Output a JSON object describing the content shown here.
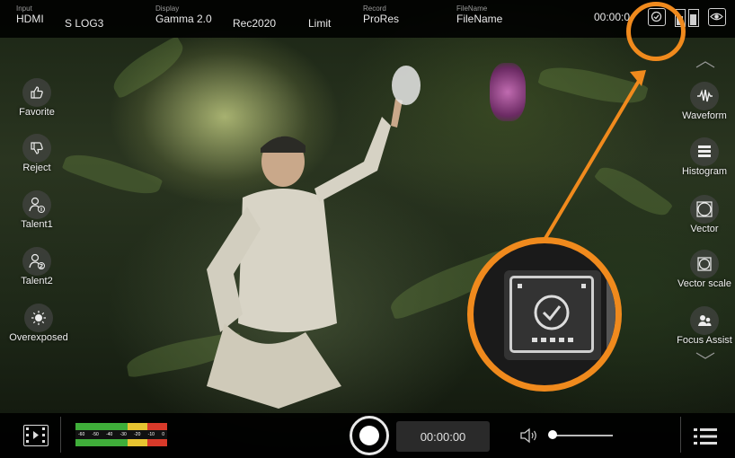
{
  "topbar": {
    "input": {
      "label": "Input",
      "value": "HDMI"
    },
    "log_format": "S LOG3",
    "display": {
      "label": "Display",
      "value": "Gamma 2.0"
    },
    "color_space": "Rec2020",
    "range": "Limit",
    "record": {
      "label": "Record",
      "value": "ProRes"
    },
    "filename": {
      "label": "FileName",
      "value": "FileName"
    },
    "timecode": "00:00:0",
    "icons": [
      "media-check-icon",
      "battery-icon",
      "eye-icon"
    ]
  },
  "left_tools": [
    {
      "label": "Favorite",
      "icon": "thumbs-up-icon"
    },
    {
      "label": "Reject",
      "icon": "thumbs-down-icon"
    },
    {
      "label": "Talent1",
      "icon": "talent-1-icon"
    },
    {
      "label": "Talent2",
      "icon": "talent-2-icon"
    },
    {
      "label": "Overexposed",
      "icon": "overexposed-icon"
    }
  ],
  "right_tools": [
    {
      "label": "Waveform",
      "icon": "waveform-icon"
    },
    {
      "label": "Histogram",
      "icon": "histogram-icon"
    },
    {
      "label": "Vector",
      "icon": "vector-icon"
    },
    {
      "label": "Vector scale",
      "icon": "vector-scale-icon"
    },
    {
      "label": "Focus Assist",
      "icon": "focus-assist-icon"
    }
  ],
  "bottombar": {
    "timecode": "00:00:00",
    "meter_scale": [
      "-60",
      "-50",
      "-40",
      "-30",
      "-20",
      "-10",
      "0"
    ],
    "volume_level": 0.05
  },
  "colors": {
    "callout": "#f08a1d",
    "meter_green": "#3fae3a",
    "meter_yellow": "#e7c431",
    "meter_red": "#d83a2a"
  }
}
